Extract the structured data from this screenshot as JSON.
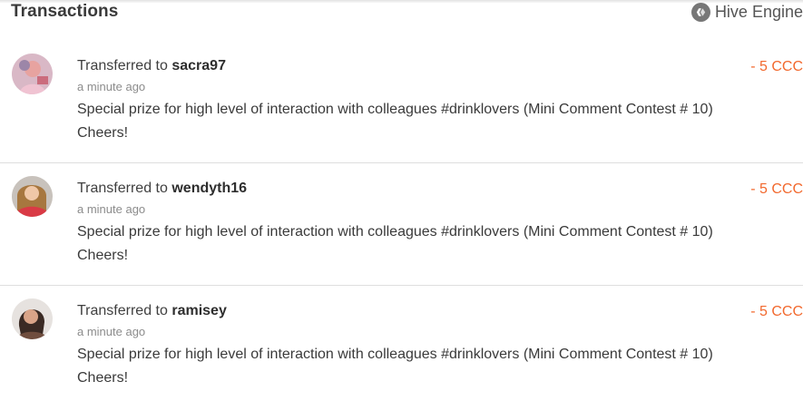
{
  "header": {
    "title": "Transactions",
    "source_label": "Hive Engine",
    "source_icon": "hive-engine-icon"
  },
  "colors": {
    "amount_negative": "#f2692e",
    "divider": "#dedede"
  },
  "transactions": [
    {
      "prefix": "Transferred to",
      "user": "sacra97",
      "time": "a minute ago",
      "memo_line1": "Special prize for high level of interaction with colleagues #drinklovers (Mini Comment Contest # 10)",
      "memo_line2": "Cheers!",
      "amount": "- 5 CCC"
    },
    {
      "prefix": "Transferred to",
      "user": "wendyth16",
      "time": "a minute ago",
      "memo_line1": "Special prize for high level of interaction with colleagues #drinklovers (Mini Comment Contest # 10)",
      "memo_line2": "Cheers!",
      "amount": "- 5 CCC"
    },
    {
      "prefix": "Transferred to",
      "user": "ramisey",
      "time": "a minute ago",
      "memo_line1": "Special prize for high level of interaction with colleagues #drinklovers (Mini Comment Contest # 10)",
      "memo_line2": "Cheers!",
      "amount": "- 5 CCC"
    }
  ]
}
